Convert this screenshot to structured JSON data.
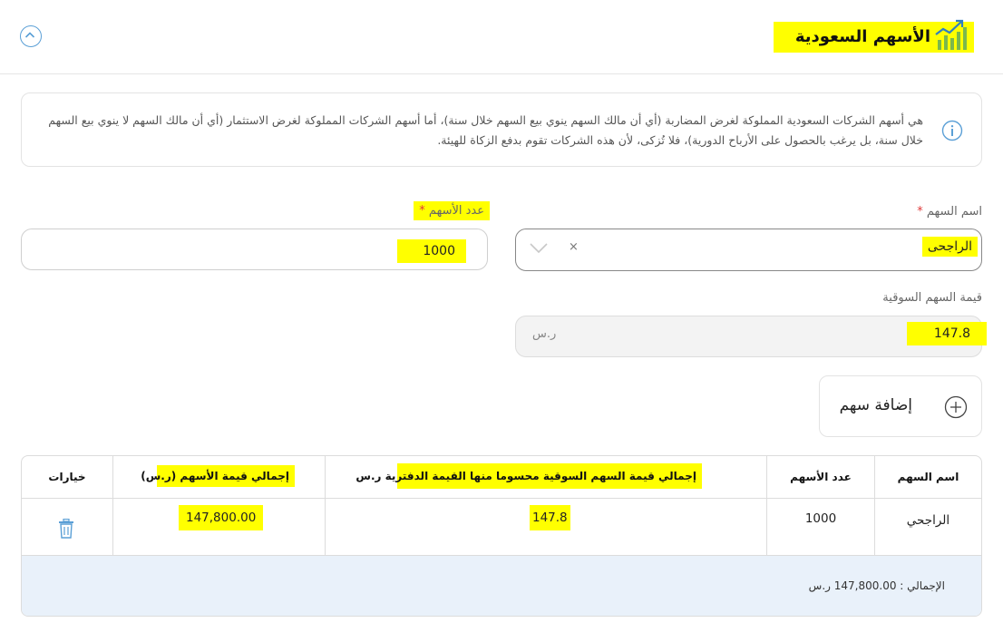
{
  "header": {
    "title": "الأسهم السعودية",
    "title_icon": "growth-chart-icon",
    "collapse_icon": "chevron-up-circle-icon"
  },
  "info": {
    "icon": "info-icon",
    "text": "هي أسهم الشركات السعودية المملوكة لغرض المضاربة (أي أن مالك السهم ينوي بيع السهم خلال سنة)، أما أسهم الشركات المملوكة لغرض الاستثمار (أي أن مالك السهم لا ينوي بيع السهم خلال سنة، بل يرغب بالحصول على الأرباح الدورية)، فلا تُزكى، لأن هذه الشركات تقوم بدفع الزكاة للهيئة."
  },
  "form": {
    "stock_name_label": "اسم السهم",
    "stock_name_value": "الراجحى",
    "shares_count_label": "عدد الأسهم",
    "shares_count_value": "1000",
    "market_value_label": "قيمة السهم السوقية",
    "market_value_value": "147.8",
    "currency": "ر.س",
    "required_mark": "*",
    "clear_symbol": "×"
  },
  "add_button": {
    "label": "إضافة سهم",
    "icon": "plus-circle-icon"
  },
  "table": {
    "headers": {
      "stock_name": "اسم السهم",
      "shares_count": "عدد الأسهم",
      "market_total": "إجمالي قيمة السهم السوقية محسوما منها القيمة الدفترية ر.س",
      "shares_total": "إجمالي قيمة الأسهم (ر.س)",
      "options": "خيارات"
    },
    "rows": [
      {
        "stock_name": "الراجحي",
        "shares_count": "1000",
        "market_total": "147.8",
        "shares_total": "147,800.00",
        "delete_icon": "trash-icon"
      }
    ],
    "total_text": "الإجمالي : 147,800.00 ر.س"
  },
  "colors": {
    "accent": "#5a9fd6",
    "highlight": "#ffff00",
    "footer_bg": "#e9f1fa",
    "required": "#e03a3a"
  }
}
